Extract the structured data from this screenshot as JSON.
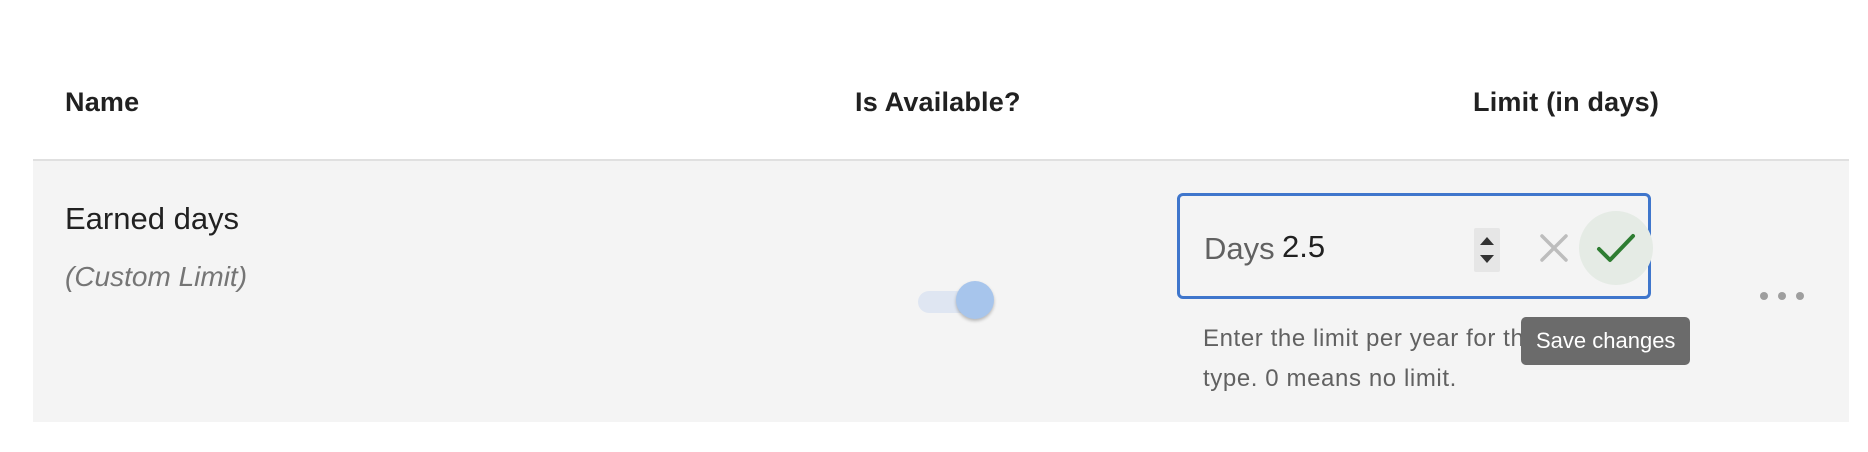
{
  "table": {
    "columns": {
      "name": "Name",
      "available": "Is Available?",
      "limit": "Limit (in days)"
    },
    "rows": [
      {
        "name": "Earned days",
        "subtitle": "(Custom Limit)",
        "is_available": true,
        "limit": {
          "prefix": "Days",
          "value": "2.5",
          "helper_text": "Enter the limit per year for this leave type. 0 means no limit."
        }
      }
    ]
  },
  "tooltip": {
    "text": "Save changes"
  },
  "icons": {
    "stepper": "number-stepper-icon",
    "cancel": "close-icon",
    "save": "check-icon",
    "more": "more-horizontal-icon"
  },
  "colors": {
    "focus_border": "#3f76cc",
    "save_check": "#2e7d32",
    "toggle_knob": "#a7c5ec",
    "row_background": "#f4f4f4"
  }
}
